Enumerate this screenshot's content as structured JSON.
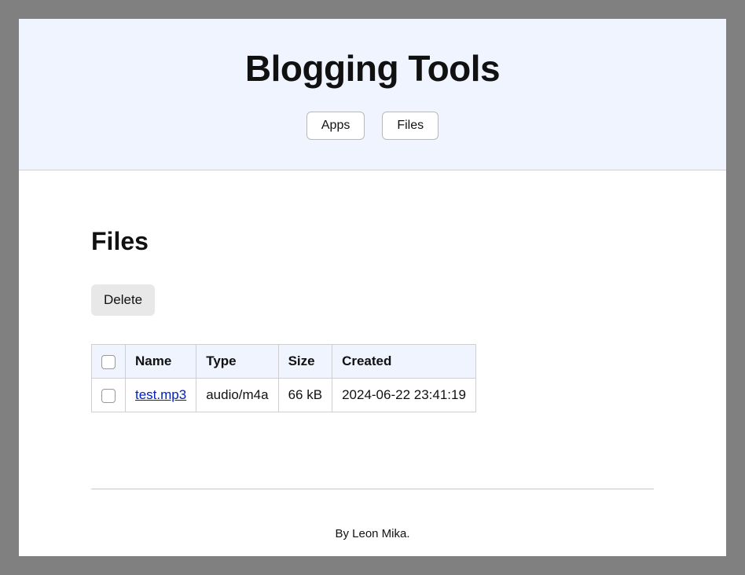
{
  "header": {
    "title": "Blogging Tools",
    "nav": {
      "apps": "Apps",
      "files": "Files"
    }
  },
  "main": {
    "heading": "Files",
    "delete_label": "Delete",
    "table": {
      "headers": {
        "name": "Name",
        "type": "Type",
        "size": "Size",
        "created": "Created"
      },
      "rows": [
        {
          "name": "test.mp3",
          "type": "audio/m4a",
          "size": "66 kB",
          "created": "2024-06-22 23:41:19"
        }
      ]
    }
  },
  "footer": {
    "text": "By Leon Mika."
  }
}
